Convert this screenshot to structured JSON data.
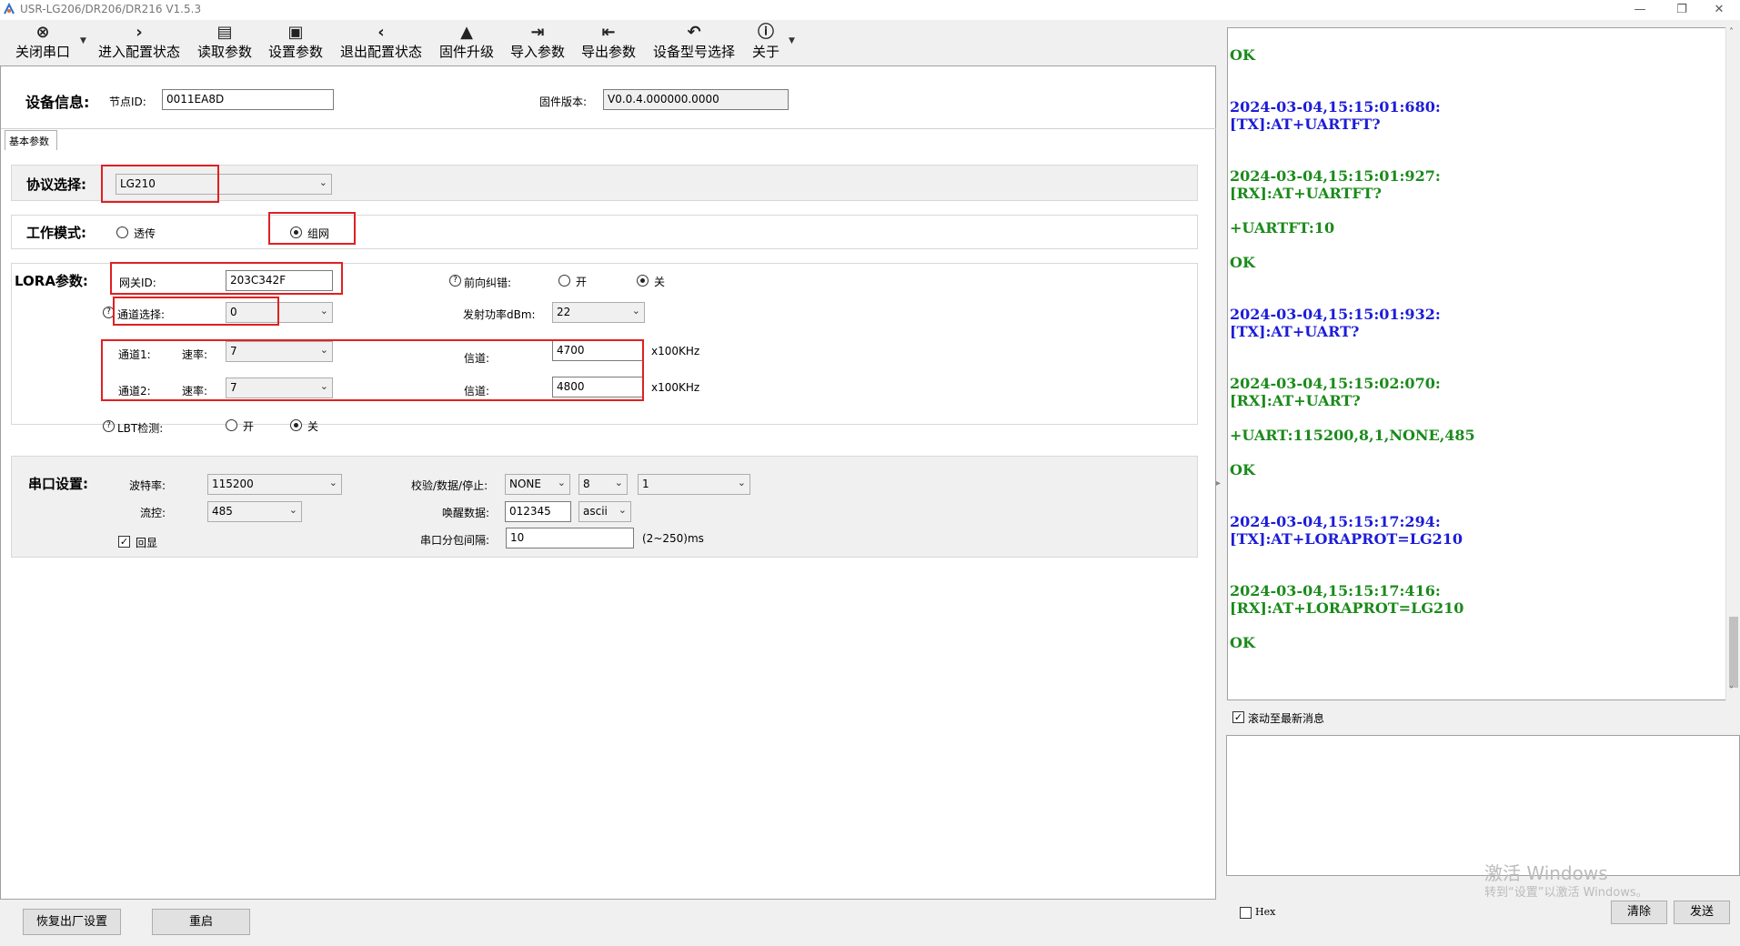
{
  "window": {
    "title": "USR-LG206/DR206/DR216 V1.5.3",
    "minimize": "—",
    "restore": "❐",
    "close": "✕"
  },
  "toolbar": {
    "close_port": "关闭串口",
    "enter_config": "进入配置状态",
    "read_params": "读取参数",
    "set_params": "设置参数",
    "exit_config": "退出配置状态",
    "firmware_upgrade": "固件升级",
    "import_params": "导入参数",
    "export_params": "导出参数",
    "device_model": "设备型号选择",
    "about": "关于"
  },
  "device_info": {
    "label": "设备信息:",
    "node_id_label": "节点ID:",
    "node_id": "0011EA8D",
    "firmware_label": "固件版本:",
    "firmware": "V0.0.4.000000.0000"
  },
  "tab": {
    "basic": "基本参数"
  },
  "protocol": {
    "label": "协议选择:",
    "value": "LG210"
  },
  "work_mode": {
    "label": "工作模式:",
    "transparent": "透传",
    "network": "组网",
    "selected": "network"
  },
  "lora": {
    "label": "LORA参数:",
    "gateway_id_label": "网关ID:",
    "gateway_id": "203C342F",
    "fec_label": "前向纠错:",
    "on": "开",
    "off": "关",
    "channel_select_label": "通道选择:",
    "channel_select": "0",
    "tx_power_label": "发射功率dBm:",
    "tx_power": "22",
    "ch1_label": "通道1:",
    "ch2_label": "通道2:",
    "rate_label": "速率:",
    "ch1_rate": "7",
    "ch2_rate": "7",
    "channel_label": "信道:",
    "ch1_channel": "4700",
    "ch2_channel": "4800",
    "unit": "x100KHz",
    "lbt_label": "LBT检测:"
  },
  "serial": {
    "label": "串口设置:",
    "baud_label": "波特率:",
    "baud": "115200",
    "parity_label": "校验/数据/停止:",
    "parity": "NONE",
    "data_bits": "8",
    "stop_bits": "1",
    "flow_label": "流控:",
    "flow": "485",
    "wake_label": "唤醒数据:",
    "wake_data": "012345",
    "wake_format": "ascii",
    "echo_label": "回显",
    "interval_label": "串口分包间隔:",
    "interval": "10",
    "interval_range": "(2~250)ms"
  },
  "buttons": {
    "factory_reset": "恢复出厂设置",
    "restart": "重启",
    "clear": "清除",
    "send": "发送"
  },
  "log": [
    {
      "text": "OK",
      "color": "green"
    },
    {
      "text": "2024-03-04,15:15:01:680:",
      "color": "blue"
    },
    {
      "text": "[TX]:AT+UARTFT?",
      "color": "blue"
    },
    {
      "text": "2024-03-04,15:15:01:927:",
      "color": "green"
    },
    {
      "text": "[RX]:AT+UARTFT?",
      "color": "green"
    },
    {
      "text": "+UARTFT:10",
      "color": "green"
    },
    {
      "text": "OK",
      "color": "green"
    },
    {
      "text": "2024-03-04,15:15:01:932:",
      "color": "blue"
    },
    {
      "text": "[TX]:AT+UART?",
      "color": "blue"
    },
    {
      "text": "2024-03-04,15:15:02:070:",
      "color": "green"
    },
    {
      "text": "[RX]:AT+UART?",
      "color": "green"
    },
    {
      "text": "+UART:115200,8,1,NONE,485",
      "color": "green"
    },
    {
      "text": "OK",
      "color": "green"
    },
    {
      "text": "2024-03-04,15:15:17:294:",
      "color": "blue"
    },
    {
      "text": "[TX]:AT+LORAPROT=LG210",
      "color": "blue"
    },
    {
      "text": "2024-03-04,15:15:17:416:",
      "color": "green"
    },
    {
      "text": "[RX]:AT+LORAPROT=LG210",
      "color": "green"
    },
    {
      "text": "OK",
      "color": "green"
    }
  ],
  "log_options": {
    "autoscroll": "滚动至最新消息",
    "hex": "Hex"
  },
  "watermark": {
    "line1": "激活 Windows",
    "line2": "转到“设置”以激活 Windows。"
  },
  "colors": {
    "highlight": "#e02020",
    "log_green": "#1a8a1a",
    "log_blue": "#1c1cd8"
  }
}
